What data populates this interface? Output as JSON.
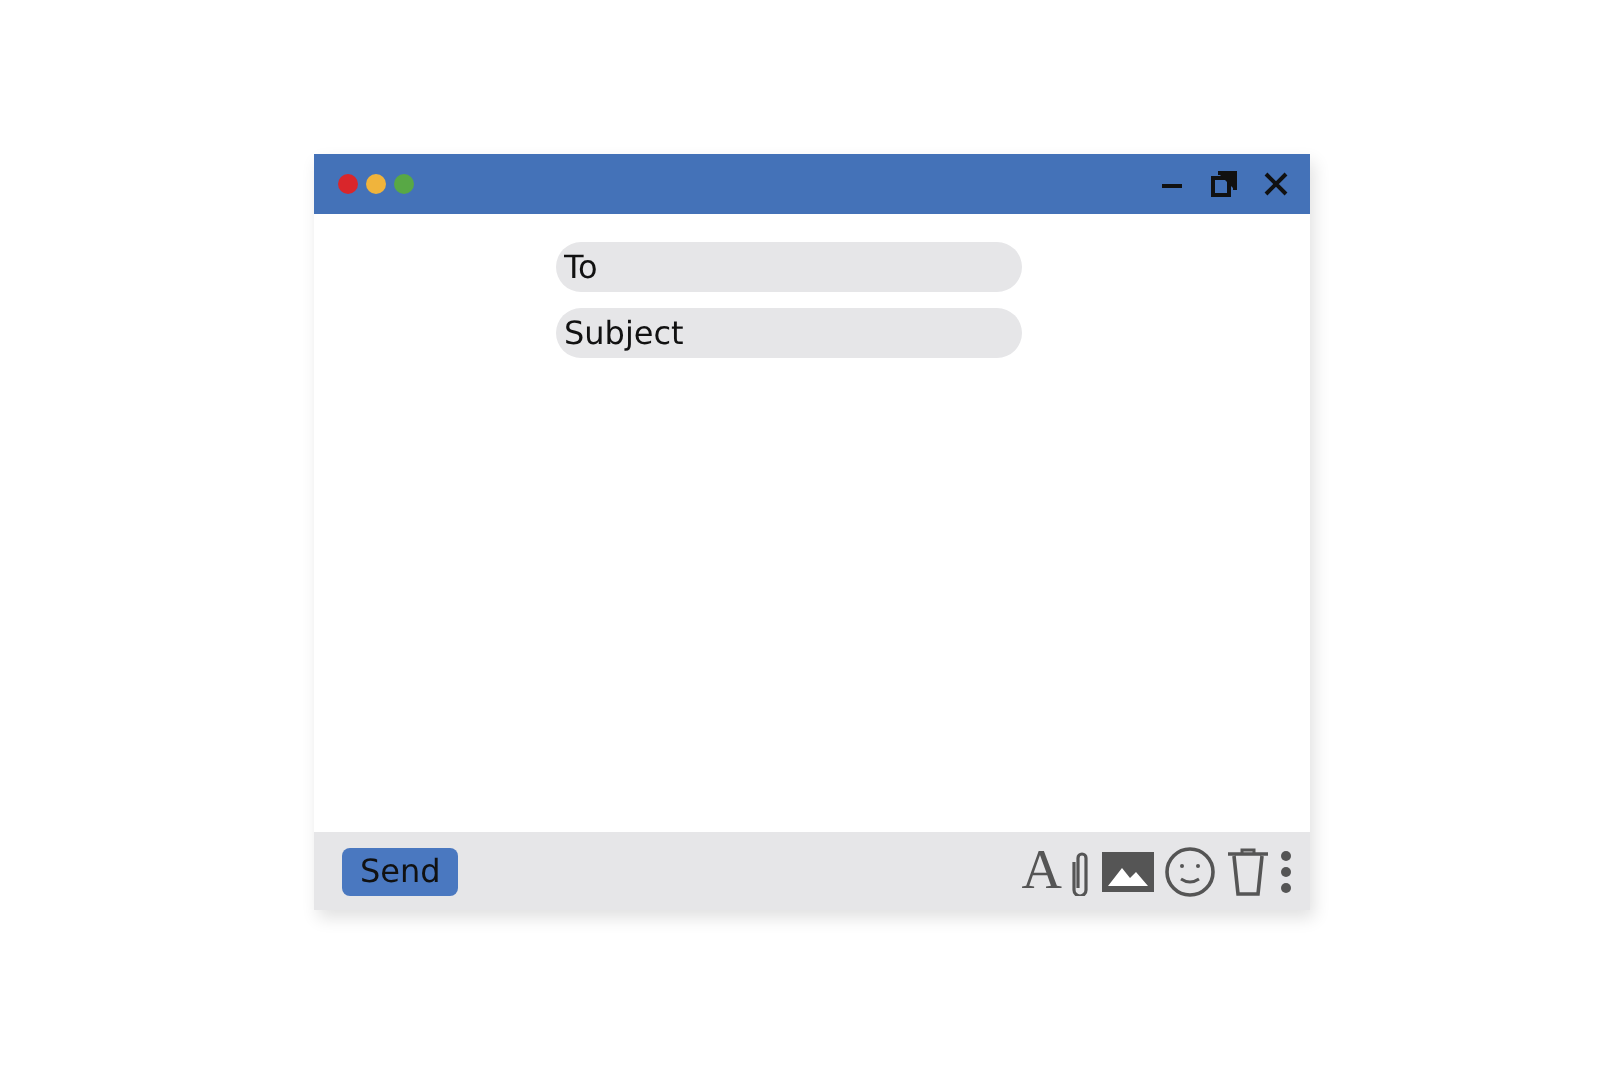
{
  "window": {
    "dots": [
      {
        "color": "#d9262b"
      },
      {
        "color": "#f0b43c"
      },
      {
        "color": "#58a845"
      }
    ],
    "controls": [
      {
        "kind": "minimize"
      },
      {
        "kind": "restore"
      },
      {
        "kind": "close"
      }
    ]
  },
  "fields": [
    {
      "placeholder": "To"
    },
    {
      "placeholder": "Subject"
    }
  ],
  "footer": {
    "send": "Send",
    "tools": [
      {
        "kind": "glyph",
        "label": "A"
      },
      {
        "kind": "attach"
      },
      {
        "kind": "image"
      },
      {
        "kind": "emoji"
      },
      {
        "kind": "trash"
      },
      {
        "kind": "more"
      }
    ]
  }
}
